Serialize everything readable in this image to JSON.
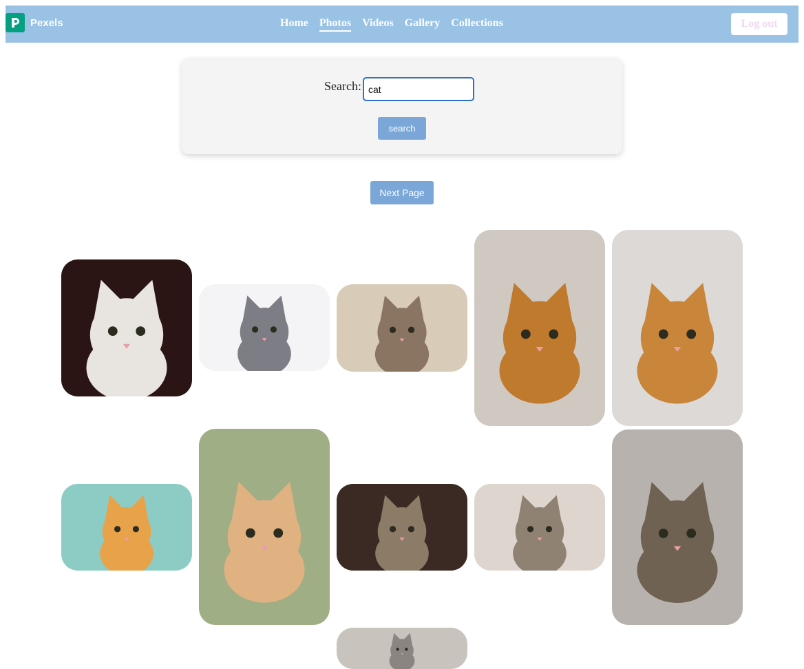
{
  "nav": {
    "brand": "Pexels",
    "links": [
      "Home",
      "Photos",
      "Videos",
      "Gallery",
      "Collections"
    ],
    "active": "Photos",
    "logout_label": "Log out"
  },
  "search": {
    "label": "Search:",
    "value": "cat",
    "button_label": "search"
  },
  "pagination": {
    "next_label": "Next Page"
  },
  "gallery": {
    "photos": [
      {
        "name": "photo-white-kitten",
        "bg": "#2a1414",
        "fg": "#e8e4e0"
      },
      {
        "name": "photo-gray-white-cat",
        "bg": "#f4f4f6",
        "fg": "#7d7d85"
      },
      {
        "name": "photo-sleeping-kitten-paws",
        "bg": "#d8cbb8",
        "fg": "#8a7462"
      },
      {
        "name": "photo-orange-cat-sitting",
        "bg": "#cfc9c2",
        "fg": "#c07a2e"
      },
      {
        "name": "photo-orange-cat-bandana",
        "bg": "#ddd9d6",
        "fg": "#c9853a"
      },
      {
        "name": "photo-orange-cat-licking",
        "bg": "#8dccc4",
        "fg": "#e8a24a"
      },
      {
        "name": "photo-kitten-at-door",
        "bg": "#9fae84",
        "fg": "#e0b281"
      },
      {
        "name": "photo-tabby-cat-lying",
        "bg": "#3b2a24",
        "fg": "#8c7b66"
      },
      {
        "name": "photo-sleeping-tabby",
        "bg": "#ded6ce",
        "fg": "#8f8273"
      },
      {
        "name": "photo-grumpy-tabby-cat",
        "bg": "#b7b2ad",
        "fg": "#6f6252"
      },
      {
        "name": "photo-cat-partial",
        "bg": "#c8c3bd",
        "fg": "#8a8580"
      }
    ]
  }
}
